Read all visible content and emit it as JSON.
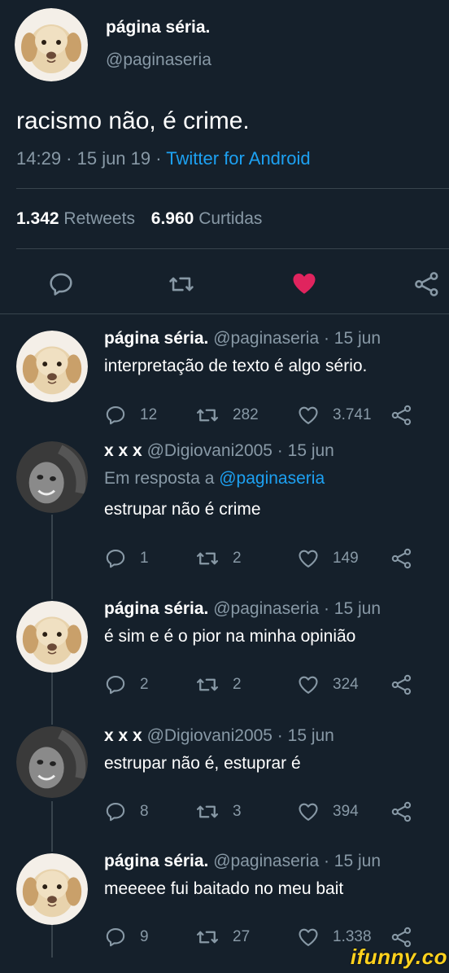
{
  "main_tweet": {
    "name": "página séria.",
    "handle": "@paginaseria",
    "text": "racismo não, é crime.",
    "time": "14:29 · 15 jun 19 · ",
    "source": "Twitter for Android",
    "retweets_count": "1.342",
    "retweets_label": "Retweets",
    "likes_count": "6.960",
    "likes_label": "Curtidas",
    "liked": true,
    "colors": {
      "like": "#e0245e",
      "link": "#1da1f2"
    }
  },
  "replies": [
    {
      "name": "página séria.",
      "meta": "@paginaseria · 15 jun",
      "text": "interpretação de texto é algo sério.",
      "counts": {
        "reply": "12",
        "retweet": "282",
        "like": "3.741"
      }
    },
    {
      "name": "x x x",
      "meta": "@Digiovani2005 · 15 jun",
      "reply_to_prefix": "Em resposta a ",
      "reply_to_handle": "@paginaseria",
      "text": "estrupar não é crime",
      "counts": {
        "reply": "1",
        "retweet": "2",
        "like": "149"
      }
    },
    {
      "name": "página séria.",
      "meta": "@paginaseria · 15 jun",
      "text": "é sim e é o pior na minha opinião",
      "counts": {
        "reply": "2",
        "retweet": "2",
        "like": "324"
      }
    },
    {
      "name": "x x x",
      "meta": "@Digiovani2005 · 15 jun",
      "text": "estrupar não é, estuprar é",
      "counts": {
        "reply": "8",
        "retweet": "3",
        "like": "394"
      }
    },
    {
      "name": "página séria.",
      "meta": "@paginaseria · 15 jun",
      "text": "meeeee fui baitado no meu bait",
      "counts": {
        "reply": "9",
        "retweet": "27",
        "like": "1.338"
      }
    }
  ],
  "watermark": "ifunny.co"
}
